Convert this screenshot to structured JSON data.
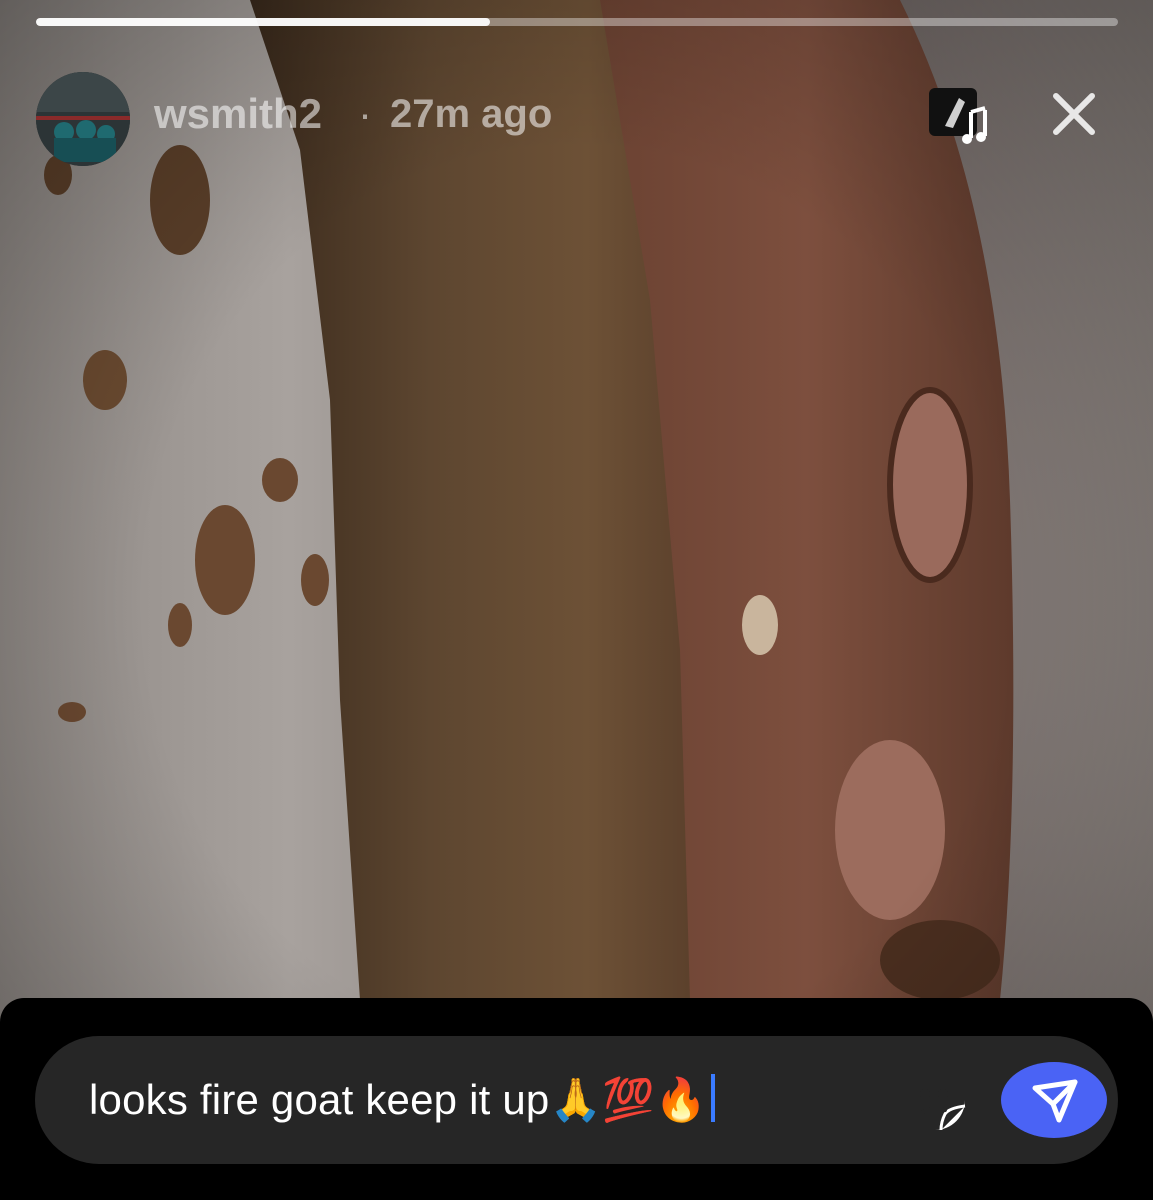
{
  "story": {
    "progress": 0.42,
    "photo_subject": "close-up of a cookie"
  },
  "header": {
    "username": "wsmith2",
    "separator": "·",
    "time_ago": "27m ago",
    "music_icon": "music-note-icon",
    "close_icon": "close-icon"
  },
  "composer": {
    "message": "looks fire goat keep it up🙏💯🔥",
    "sticker_icon": "sticker-icon",
    "send_icon": "send-icon",
    "send_color": "#4a63f5"
  }
}
